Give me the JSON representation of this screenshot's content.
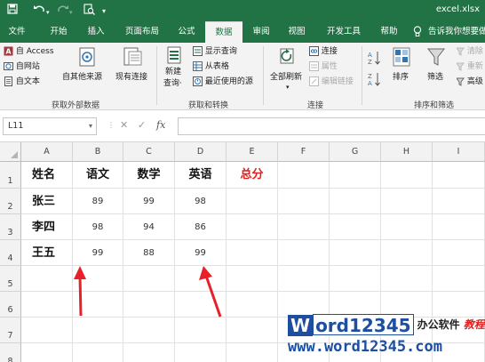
{
  "window": {
    "filename": "excel.xlsx"
  },
  "tabs": [
    {
      "label": "文件"
    },
    {
      "label": "开始"
    },
    {
      "label": "插入"
    },
    {
      "label": "页面布局"
    },
    {
      "label": "公式"
    },
    {
      "label": "数据"
    },
    {
      "label": "审阅"
    },
    {
      "label": "视图"
    },
    {
      "label": "开发工具"
    },
    {
      "label": "帮助"
    },
    {
      "label": "告诉我你想要做什么"
    }
  ],
  "active_tab": "数据",
  "ribbon": {
    "get_external": {
      "access": "自 Access",
      "web": "自网站",
      "text": "自文本",
      "other": "自其他来源",
      "existing": "现有连接",
      "label": "获取外部数据"
    },
    "transform": {
      "new_query": "新建",
      "new_query2": "查询·",
      "show_queries": "显示查询",
      "from_table": "从表格",
      "recent": "最近使用的源",
      "label": "获取和转换"
    },
    "connections": {
      "refresh": "全部刷新",
      "refresh_dd": "▾",
      "conn": "连接",
      "props": "属性",
      "edit_links": "编辑链接",
      "label": "连接"
    },
    "sort_filter": {
      "sort": "排序",
      "filter": "筛选",
      "clear": "清除",
      "reapply": "重新",
      "advanced": "高级",
      "label": "排序和筛选"
    }
  },
  "formula_bar": {
    "name_box": "L11",
    "cancel": "✕",
    "enter": "✓",
    "fx": "fx",
    "value": ""
  },
  "columns": [
    "A",
    "B",
    "C",
    "D",
    "E",
    "F",
    "G",
    "H",
    "I"
  ],
  "rows": [
    "1",
    "2",
    "3",
    "4",
    "5",
    "6",
    "7",
    "8"
  ],
  "sheet": {
    "header": [
      "姓名",
      "语文",
      "数学",
      "英语",
      "总分"
    ],
    "data": [
      [
        "张三",
        "89",
        "99",
        "98"
      ],
      [
        "李四",
        "98",
        "94",
        "86"
      ],
      [
        "王五",
        "99",
        "88",
        "99"
      ]
    ]
  },
  "colors": {
    "excel_green": "#217346",
    "total_red": "#e02020",
    "arrow_red": "#e8202a",
    "watermark_blue": "#1d4ea0"
  },
  "watermark": {
    "word": "W",
    "rest": "ord12345",
    "cn1": "办公软件",
    "cn2": "教程",
    "url": "www.word12345.com"
  }
}
